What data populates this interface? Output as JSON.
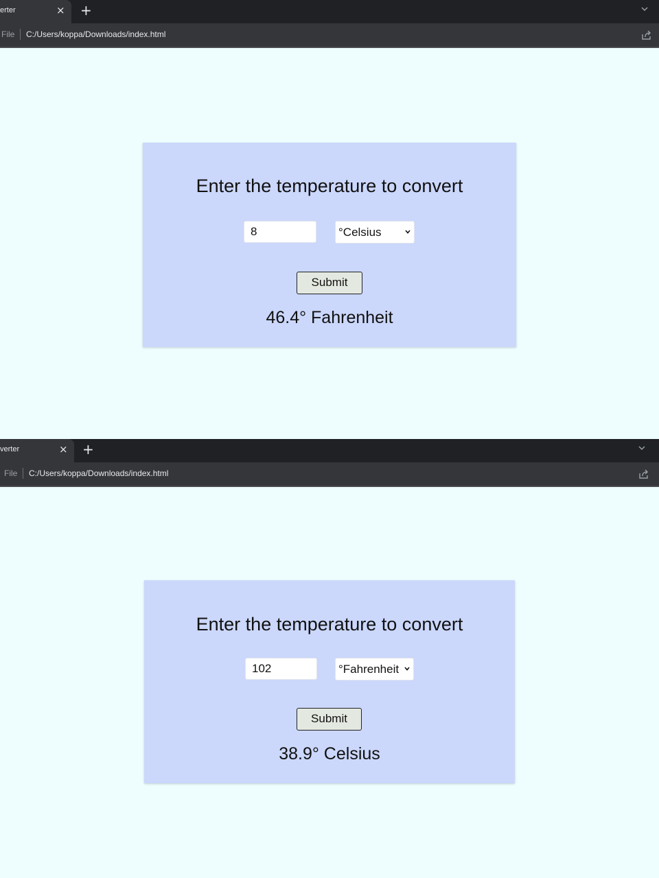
{
  "screens": [
    {
      "browser": {
        "tab_title": "erter",
        "tab_close": "×",
        "new_tab": "+",
        "file_label": "File",
        "url": "C:/Users/koppa/Downloads/index.html"
      },
      "form": {
        "heading": "Enter the temperature to convert",
        "input_value": "8",
        "selected_unit": "°Celsius",
        "submit_label": "Submit",
        "result": "46.4° Fahrenheit"
      }
    },
    {
      "browser": {
        "tab_title": "verter",
        "tab_close": "×",
        "new_tab": "+",
        "file_label": "File",
        "url": "C:/Users/koppa/Downloads/index.html"
      },
      "form": {
        "heading": "Enter the temperature to convert",
        "input_value": "102",
        "selected_unit": "°Fahrenheit",
        "submit_label": "Submit",
        "result": "38.9° Celsius"
      }
    }
  ],
  "colors": {
    "page_background": "#eefeff",
    "panel_background": "#cbd7fb",
    "browser_chrome": "#202124",
    "submit_background": "#e3e8e0"
  }
}
